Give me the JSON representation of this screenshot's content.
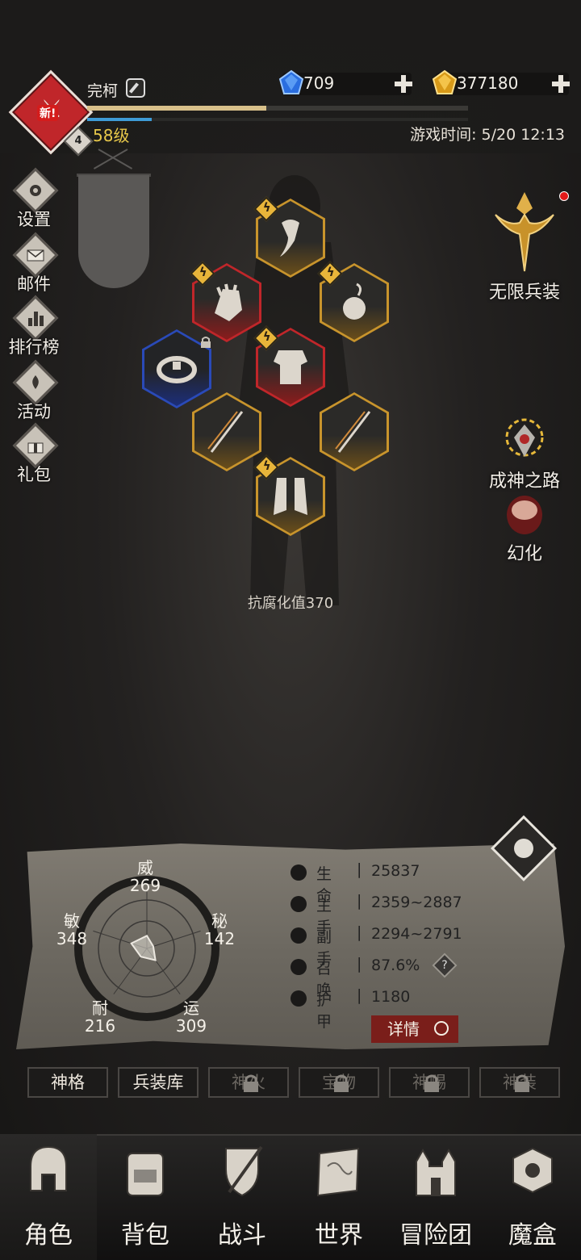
{
  "header": {
    "avatar_badge": "新!",
    "player_name": "完柯",
    "small_level": "4",
    "level": "58级",
    "exp_percent": 47,
    "sub_percent": 17,
    "game_time": "游戏时间: 5/20 12:13"
  },
  "currency": {
    "gems": "709",
    "gold": "377180"
  },
  "left_menu": {
    "items": [
      {
        "label": "设置",
        "icon": "gear-icon"
      },
      {
        "label": "邮件",
        "icon": "mail-icon"
      },
      {
        "label": "排行榜",
        "icon": "ranking-icon"
      },
      {
        "label": "活动",
        "icon": "event-icon"
      },
      {
        "label": "礼包",
        "icon": "gift-icon"
      }
    ]
  },
  "right_menu": {
    "items": [
      {
        "label": "无限兵装",
        "icon": "infinite-arms-icon"
      },
      {
        "label": "成神之路",
        "icon": "godhood-path-icon"
      },
      {
        "label": "幻化",
        "icon": "transmog-icon"
      }
    ]
  },
  "character": {
    "corruption_resist": "抗腐化值370"
  },
  "stats": {
    "radar": [
      {
        "name": "威",
        "value": "269"
      },
      {
        "name": "秘",
        "value": "142"
      },
      {
        "name": "运",
        "value": "309"
      },
      {
        "name": "耐",
        "value": "216"
      },
      {
        "name": "敏",
        "value": "348"
      }
    ],
    "rows": [
      {
        "name": "生命",
        "sep": "|",
        "value": "25837",
        "icon": "heart-icon"
      },
      {
        "name": "主手",
        "sep": "|",
        "value": "2359~2887",
        "icon": "main-hand-icon"
      },
      {
        "name": "副手",
        "sep": "|",
        "value": "2294~2791",
        "icon": "off-hand-icon"
      },
      {
        "name": "召唤",
        "sep": "|",
        "value": "87.6%",
        "icon": "summon-icon"
      },
      {
        "name": "护甲",
        "sep": "|",
        "value": "1180",
        "icon": "armor-icon"
      }
    ],
    "help": "?",
    "detail_label": "详情"
  },
  "tabs": [
    {
      "label": "神格",
      "locked": false
    },
    {
      "label": "兵装库",
      "locked": false
    },
    {
      "label": "神火",
      "locked": true
    },
    {
      "label": "宝物",
      "locked": true
    },
    {
      "label": "神赐",
      "locked": true
    },
    {
      "label": "神装",
      "locked": true
    }
  ],
  "bottom_nav": [
    {
      "label": "角色",
      "icon": "helmet-icon",
      "active": true
    },
    {
      "label": "背包",
      "icon": "backpack-icon",
      "active": false
    },
    {
      "label": "战斗",
      "icon": "battle-shield-icon",
      "active": false
    },
    {
      "label": "世界",
      "icon": "world-map-icon",
      "active": false
    },
    {
      "label": "冒险团",
      "icon": "castle-icon",
      "active": false
    },
    {
      "label": "魔盒",
      "icon": "magic-cube-icon",
      "active": false
    }
  ],
  "colors": {
    "accent_gold": "#c8942c",
    "rarity_red": "#c0262a",
    "rarity_blue": "#2a4ab8",
    "level_yellow": "#e7c84a"
  }
}
